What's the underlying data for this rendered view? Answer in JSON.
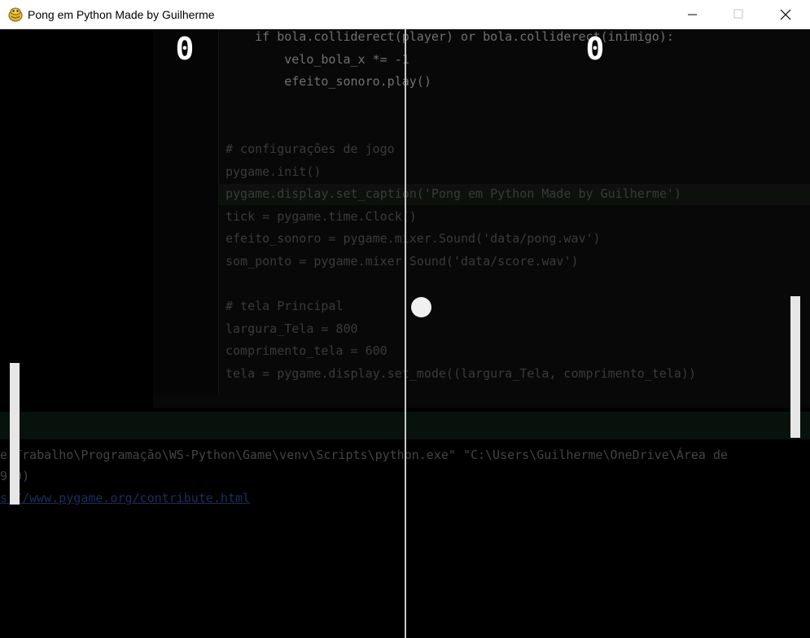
{
  "window": {
    "title": "Pong em Python Made by Guilherme",
    "icon": "python-snake-icon",
    "controls": [
      "minimize-icon",
      "maximize-icon",
      "close-icon"
    ]
  },
  "game": {
    "score_left": "0",
    "score_right": "0",
    "colors": {
      "background": "#000000",
      "foreground": "#e6e6e6",
      "net": "#c8c8c8"
    }
  },
  "ghost_editor": {
    "code_lines": [
      "    if bola.colliderect(player) or bola.colliderect(inimigo):",
      "        velo_bola_x *= -1",
      "        efeito_sonoro.play()",
      "",
      "",
      "# configurações de jogo",
      "pygame.init()",
      "pygame.display.set_caption('Pong em Python Made by Guilherme')",
      "tick = pygame.time.Clock()",
      "efeito_sonoro = pygame.mixer.Sound('data/pong.wav')",
      "som_ponto = pygame.mixer.Sound('data/score.wav')",
      "",
      "# tela Principal",
      "largura_Tela = 800",
      "comprimento_tela = 600",
      "tela = pygame.display.set_mode((largura_Tela, comprimento_tela))"
    ],
    "terminal_lines": [
      "e Trabalho\\Programação\\WS-Python\\Game\\venv\\Scripts\\python.exe\" \"C:\\Users\\Guilherme\\OneDrive\\Área de",
      "9.9)",
      "s://www.pygame.org/contribute.html"
    ]
  }
}
